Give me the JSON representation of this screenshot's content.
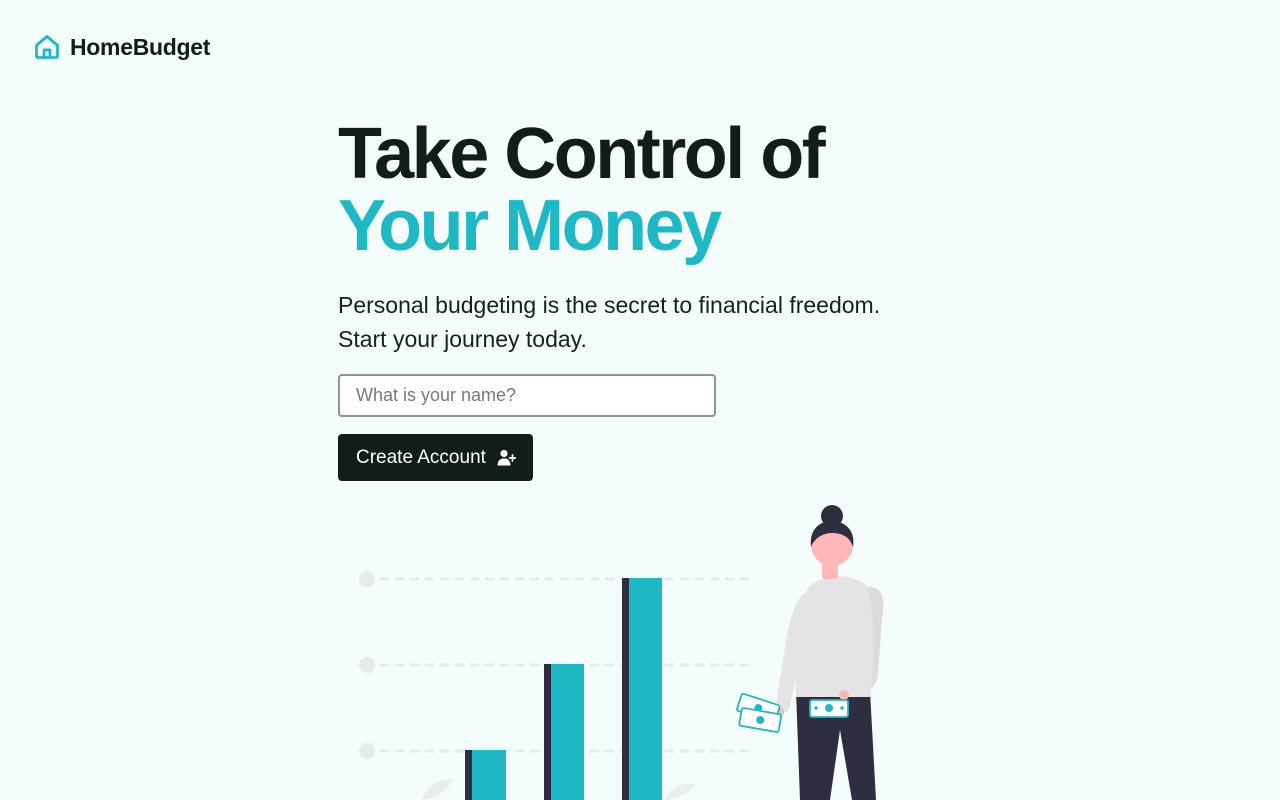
{
  "brand": {
    "name": "HomeBudget",
    "icon": "house-icon",
    "accent_color": "#1fb9c6"
  },
  "hero": {
    "title_line1": "Take Control of",
    "title_line2": "Your Money",
    "subtitle_line1": "Personal budgeting is the secret to financial freedom.",
    "subtitle_line2": "Start your journey today."
  },
  "form": {
    "name_value": "",
    "name_placeholder": "What is your name?",
    "submit_label": "Create Account",
    "submit_icon": "user-plus-icon"
  },
  "illustration": {
    "subject": "growth-bar-chart-and-woman-holding-cash",
    "bar_levels": [
      0.3,
      0.6,
      0.9
    ],
    "bar_color": "#1fb9c6",
    "shadow_color": "#2f2e41"
  }
}
